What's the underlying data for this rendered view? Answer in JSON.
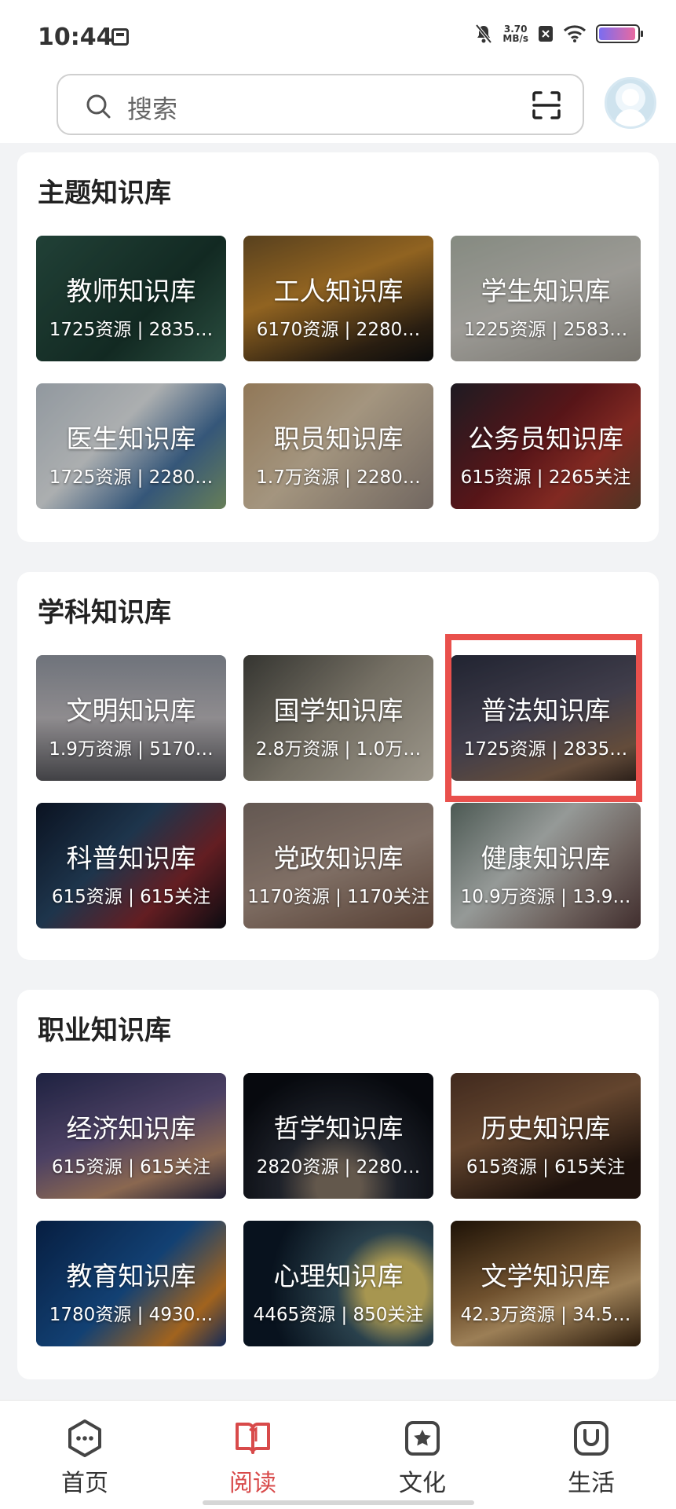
{
  "status_bar": {
    "time": "10:44",
    "net_speed_value": "3.70",
    "net_speed_unit": "MB/s",
    "battery_level": 0.95
  },
  "search": {
    "placeholder": "搜索"
  },
  "sections": [
    {
      "title": "主题知识库",
      "tiles": [
        {
          "name": "教师知识库",
          "stats": "1725资源 | 2835…"
        },
        {
          "name": "工人知识库",
          "stats": "6170资源 | 2280…"
        },
        {
          "name": "学生知识库",
          "stats": "1225资源 | 2583…"
        },
        {
          "name": "医生知识库",
          "stats": "1725资源 | 2280…"
        },
        {
          "name": "职员知识库",
          "stats": "1.7万资源 | 2280…"
        },
        {
          "name": "公务员知识库",
          "stats": "615资源 | 2265关注"
        }
      ]
    },
    {
      "title": "学科知识库",
      "tiles": [
        {
          "name": "文明知识库",
          "stats": "1.9万资源 | 5170…"
        },
        {
          "name": "国学知识库",
          "stats": "2.8万资源 | 1.0万…"
        },
        {
          "name": "普法知识库",
          "stats": "1725资源 | 2835…"
        },
        {
          "name": "科普知识库",
          "stats": "615资源 | 615关注"
        },
        {
          "name": "党政知识库",
          "stats": "1170资源 | 1170关注"
        },
        {
          "name": "健康知识库",
          "stats": "10.9万资源 | 13.9…"
        }
      ]
    },
    {
      "title": "职业知识库",
      "tiles": [
        {
          "name": "经济知识库",
          "stats": "615资源 | 615关注"
        },
        {
          "name": "哲学知识库",
          "stats": "2820资源 | 2280…"
        },
        {
          "name": "历史知识库",
          "stats": "615资源 | 615关注"
        },
        {
          "name": "教育知识库",
          "stats": "1780资源 | 4930…"
        },
        {
          "name": "心理知识库",
          "stats": "4465资源 | 850关注"
        },
        {
          "name": "文学知识库",
          "stats": "42.3万资源 | 34.5…"
        }
      ]
    }
  ],
  "bottom_nav": [
    {
      "label": "首页",
      "icon": "home-hexagon-icon"
    },
    {
      "label": "阅读",
      "icon": "book-icon",
      "active": true
    },
    {
      "label": "文化",
      "icon": "star-square-icon"
    },
    {
      "label": "生活",
      "icon": "smile-square-icon"
    }
  ],
  "colors": {
    "accent": "#d84a4a",
    "highlight_box": "#e9504c",
    "background": "#f2f3f5"
  }
}
